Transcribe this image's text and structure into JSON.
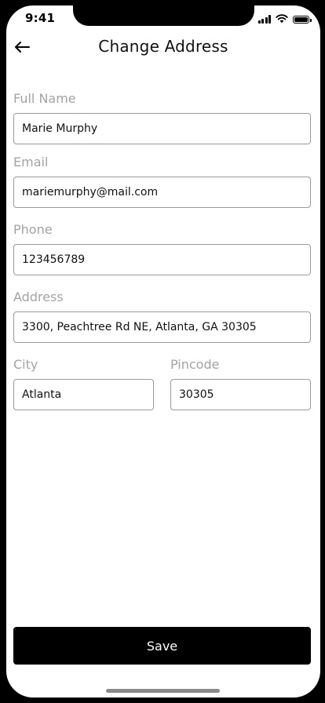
{
  "status_bar": {
    "time": "9:41",
    "icons": [
      "cellular-signal-icon",
      "wifi-icon",
      "battery-icon"
    ]
  },
  "header": {
    "back_icon": "arrow-left-icon",
    "title": "Change Address"
  },
  "form": {
    "full_name": {
      "label": "Full Name",
      "value": "Marie Murphy"
    },
    "email": {
      "label": "Email",
      "value": "mariemurphy@mail.com"
    },
    "phone": {
      "label": "Phone",
      "value": "123456789"
    },
    "address": {
      "label": "Address",
      "value": "3300, Peachtree Rd NE, Atlanta, GA 30305"
    },
    "city": {
      "label": "City",
      "value": "Atlanta"
    },
    "pincode": {
      "label": "Pincode",
      "value": "30305"
    }
  },
  "actions": {
    "save_label": "Save"
  },
  "colors": {
    "primary": "#000000",
    "label": "#a3a3a3",
    "border": "#9a9a9a",
    "background": "#ffffff"
  }
}
